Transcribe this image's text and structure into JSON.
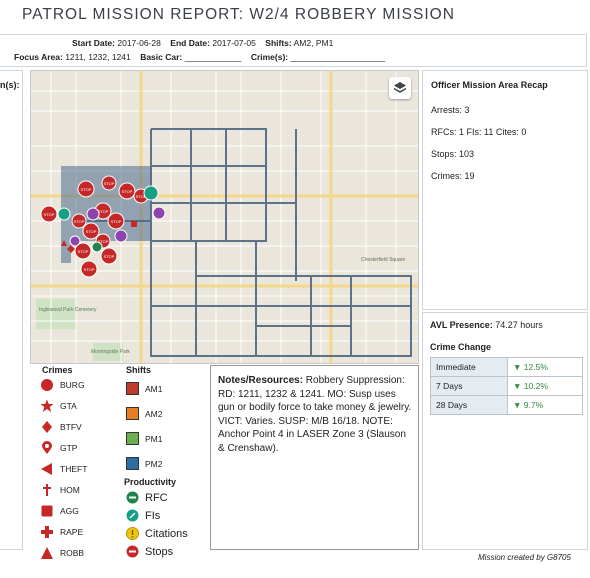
{
  "title": "PATROL MISSION REPORT: W2/4 ROBBERY MISSION",
  "header": {
    "start_label": "Start Date:",
    "start_value": "2017-06-28",
    "end_label": "End Date:",
    "end_value": "2017-07-05",
    "shifts_label": "Shifts:",
    "shifts_value": "AM2, PM1",
    "focus_label": "Focus Area:",
    "focus_value": "1211, 1232, 1241",
    "car_label": "Basic Car:",
    "car_value": "____________",
    "crimes_label": "Crime(s):",
    "crimes_value": "____________________"
  },
  "left_panel_label": "n(s):",
  "map": {
    "layers_button": "layers-icon",
    "stop_label": "STOP",
    "place_labels": [
      "Inglewood Park Cemetery",
      "Morningside Park",
      "Chesterfield Square"
    ]
  },
  "recap": {
    "title": "Officer Mission Area Recap",
    "arrests": "Arrests: 3",
    "rfcs": "RFCs: 1 FIs: 11 Cites: 0",
    "stops": "Stops: 103",
    "crimes": "Crimes: 19"
  },
  "avl": {
    "label": "AVL Presence:",
    "value": "74.27 hours"
  },
  "crime_change": {
    "title": "Crime Change",
    "rows": [
      {
        "period": "Immediate",
        "value": "▼ 12.5%"
      },
      {
        "period": "7 Days",
        "value": "▼ 10.2%"
      },
      {
        "period": "28 Days",
        "value": "▼ 9.7%"
      }
    ]
  },
  "legend": {
    "crimes_title": "Crimes",
    "crimes": [
      "BURG",
      "GTA",
      "BTFV",
      "GTP",
      "THEFT",
      "HOM",
      "AGG",
      "RAPE",
      "ROBB"
    ],
    "shifts_title": "Shifts",
    "shifts": [
      {
        "label": "AM1",
        "color": "#c0392b"
      },
      {
        "label": "AM2",
        "color": "#e67e22"
      },
      {
        "label": "PM1",
        "color": "#6ab04c"
      },
      {
        "label": "PM2",
        "color": "#2e6da4"
      }
    ],
    "productivity_title": "Productivity",
    "productivity": [
      "RFC",
      "FIs",
      "Citations",
      "Stops"
    ]
  },
  "notes": {
    "label": "Notes/Resources:",
    "text": " Robbery Suppression: RD: 1211, 1232 & 1241. MO: Susp uses gun or bodily force to take money & jewelry. VICT: Varies. SUSP: M/B 16/18. NOTE: Anchor Point 4 in LASER Zone 3 (Slauson & Crenshaw)."
  },
  "footer": "Mission created by G8705",
  "colors": {
    "crime_red": "#c62828",
    "grid_blue": "#5d7389",
    "rfc_green": "#1e8449",
    "fi_teal": "#16a085",
    "cite_yellow": "#f1c40f"
  }
}
